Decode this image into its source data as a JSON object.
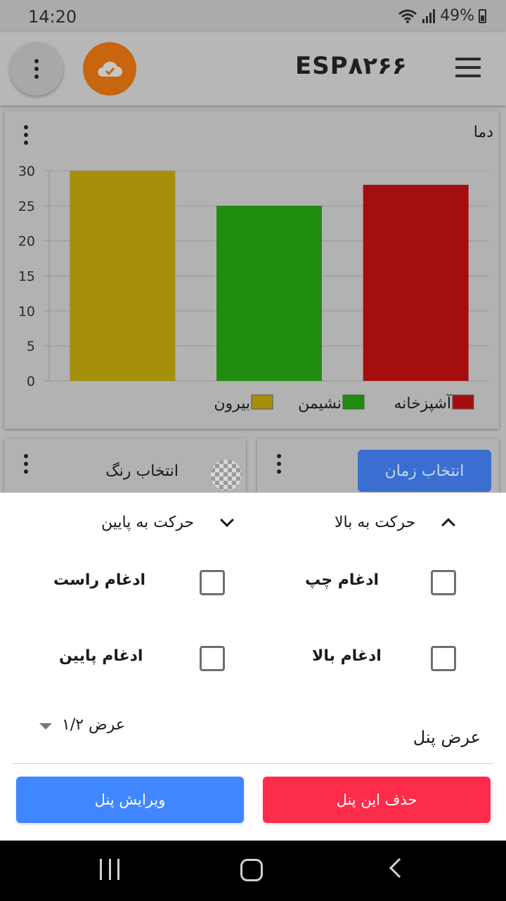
{
  "status": {
    "time": "14:20",
    "battery": "49%"
  },
  "app_bar": {
    "title": "ESP۸۲۶۶"
  },
  "chart_panel": {
    "title": "دما"
  },
  "chart_data": {
    "type": "bar",
    "categories": [
      "آشپزخانه",
      "نشیمن",
      "بیرون"
    ],
    "values": [
      28,
      25,
      30
    ],
    "colors": [
      "#a50e0e",
      "#208c0f",
      "#a68f0b"
    ],
    "title": "دما",
    "xlabel": "",
    "ylabel": "",
    "ylim": [
      0,
      30
    ],
    "yticks": [
      0,
      5,
      10,
      15,
      20,
      25,
      30
    ],
    "grid": true,
    "legend": "bottom"
  },
  "panels": {
    "color_picker_label": "انتخاب رنگ",
    "time_picker_label": "انتخاب زمان"
  },
  "sheet": {
    "move_up": "حرکت به بالا",
    "move_down": "حرکت به پایین",
    "merge_left": "ادغام چپ",
    "merge_right": "ادغام راست",
    "merge_top": "ادغام بالا",
    "merge_bottom": "ادغام پایین",
    "panel_width_label": "عرض پنل",
    "panel_width_value": "عرض ۱/۲",
    "edit_button": "ویرایش پنل",
    "delete_button": "حذف این پنل"
  }
}
